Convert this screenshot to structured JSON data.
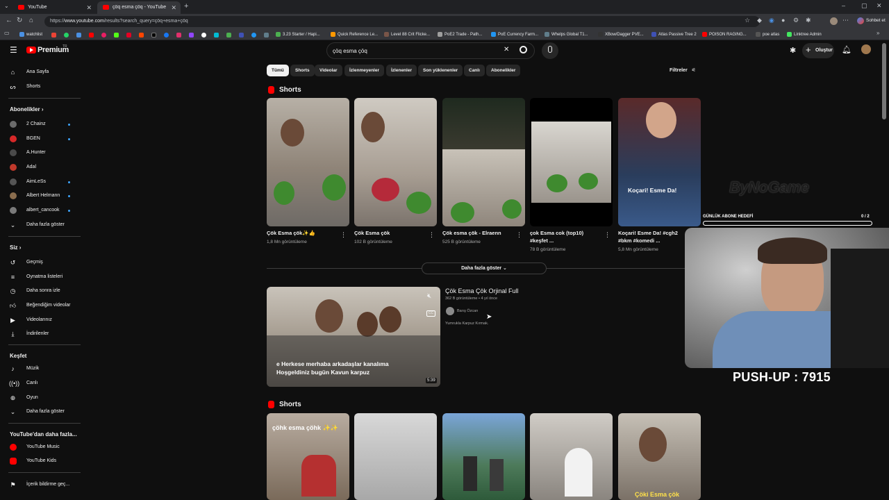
{
  "browser": {
    "tabs": [
      {
        "label": "YouTube",
        "active": false
      },
      {
        "label": "çöq esma çöq - YouTube",
        "active": true
      }
    ],
    "url_prefix": "https://",
    "url_host": "www.youtube.com",
    "url_path": "/results?search_query=çöq+esma+çöq",
    "profile_label": "Sohbet et",
    "bookmarks": [
      "watchlist",
      "3.23 Starter / Hapi...",
      "Quick Reference Le...",
      "Level 88 Crit Flicke...",
      "PoE2 Trade - Path...",
      "PoE Currency Farm...",
      "Whelps Global T1...",
      "XBow/Dagger PVE...",
      "Atlas Passive Tree 2",
      "POISON RAGING...",
      "poe atlas",
      "Linktree Admin"
    ]
  },
  "header": {
    "logo_text": "Premium",
    "logo_sup": "TR",
    "search_value": "çöq esma çöq",
    "create_label": "Oluştur"
  },
  "sidebar": {
    "main": [
      {
        "label": "Ana Sayfa",
        "icon": "home-icon"
      },
      {
        "label": "Shorts",
        "icon": "shorts-icon"
      }
    ],
    "subs_title": "Abonelikler",
    "subs": [
      {
        "label": "2 Chainz",
        "color": "#6b6b6b",
        "dot": true
      },
      {
        "label": "BGEN",
        "color": "#d62828",
        "dot": true
      },
      {
        "label": "A.Hunter",
        "color": "#4a4a4a",
        "dot": false
      },
      {
        "label": "Adal",
        "color": "#c0392b",
        "dot": false
      },
      {
        "label": "AimLeSs",
        "color": "#555",
        "dot": true
      },
      {
        "label": "Albert Helmann",
        "color": "#8a6d4e",
        "dot": true
      },
      {
        "label": "albert_cancook",
        "color": "#7a7a7a",
        "dot": true
      }
    ],
    "subs_more": "Daha fazla göster",
    "you_title": "Siz",
    "you": [
      {
        "label": "Geçmiş",
        "icon": "history-icon"
      },
      {
        "label": "Oynatma listeleri",
        "icon": "playlist-icon"
      },
      {
        "label": "Daha sonra izle",
        "icon": "clock-icon"
      },
      {
        "label": "Beğendiğim videolar",
        "icon": "thumbs-up-icon"
      },
      {
        "label": "Videolarınız",
        "icon": "video-icon"
      },
      {
        "label": "İndirilenler",
        "icon": "download-icon"
      }
    ],
    "explore_title": "Keşfet",
    "explore": [
      {
        "label": "Müzik",
        "icon": "music-icon"
      },
      {
        "label": "Canlı",
        "icon": "live-icon"
      },
      {
        "label": "Oyun",
        "icon": "gamepad-icon"
      }
    ],
    "explore_more": "Daha fazla göster",
    "more_title": "YouTube'dan daha fazla...",
    "more": [
      {
        "label": "YouTube Music",
        "icon": "youtube-music-icon"
      },
      {
        "label": "YouTube Kids",
        "icon": "youtube-kids-icon"
      }
    ],
    "report_label": "İçerik bildirme geç..."
  },
  "chips": [
    "Tümü",
    "Shorts",
    "Videolar",
    "İzlenmeyenler",
    "İzlenenler",
    "Son yüklenenler",
    "Canlı",
    "Abonelikler"
  ],
  "filters_label": "Filtreler",
  "shorts_title": "Shorts",
  "shorts_row1": [
    {
      "title": "Çök Esma çök✨👍",
      "views": "1,8 Mn görüntüleme"
    },
    {
      "title": "Çök Esma çök",
      "views": "102 B görüntüleme"
    },
    {
      "title": "Çök esma çök - Elraenn",
      "views": "525 B görüntüleme"
    },
    {
      "title": "çok Esma cok (top10) #keşfet ...",
      "views": "78 B görüntüleme"
    },
    {
      "title": "Koçari! Esme Da! #cgh2 #bkm #komedi ...",
      "views": "5,8 Mn görüntüleme"
    }
  ],
  "show_more": "Daha fazla göster",
  "video": {
    "title": "Çök Esma Çök Orjinal Full",
    "meta": "362 B görüntüleme • 4 yıl önce",
    "channel": "Barış Özcan",
    "desc": "Yumrukla Karpuz Kırmak.",
    "caption_line1": "e Herkese merhaba arkadaşlar kanalıma",
    "caption_line2": "Hoşgeldiniz bugün Kavun karpuz",
    "duration": "5:39"
  },
  "shorts2_title": "Shorts",
  "shorts_row2_overlays": [
    "çöhk esma çöhk ✨✨",
    "Çöki Esma çök"
  ],
  "thumb_overlays": {
    "short5": "Koçari! Esme Da!"
  },
  "overlay": {
    "brand": "ByNoGame",
    "goal_label": "GÜNLÜK ABONE HEDEFİ",
    "goal_count": "0 / 2",
    "goal_progress": 0,
    "pushup": "PUSH-UP : 7915"
  }
}
